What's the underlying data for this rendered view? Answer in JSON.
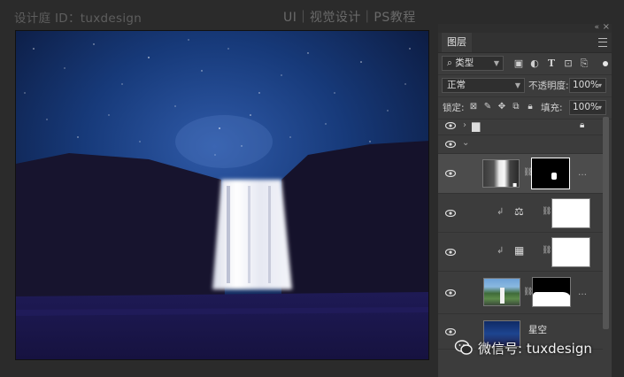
{
  "header": {
    "left_text": "设计庭 ID：tuxdesign",
    "right_text": "UI｜视觉设计｜PS教程"
  },
  "panel": {
    "tab": "图层",
    "collapse_icon": "double-chevron-icon",
    "filter": {
      "label": "类型",
      "icons": [
        "image-filter-icon",
        "adjustment-filter-icon",
        "type-filter-icon",
        "shape-filter-icon",
        "smart-object-filter-icon"
      ]
    },
    "blend_mode": "正常",
    "opacity_label": "不透明度:",
    "opacity_value": "100%",
    "lock_label": "锁定:",
    "fill_label": "填充:",
    "fill_value": "100%",
    "layers": [
      {
        "type": "group",
        "expanded": false,
        "locked": true
      },
      {
        "type": "group",
        "expanded": true
      },
      {
        "type": "smart-object",
        "selected": true
      },
      {
        "type": "adjustment",
        "icon": "balance-icon"
      },
      {
        "type": "adjustment",
        "icon": "grid-icon"
      },
      {
        "type": "image-with-mask"
      },
      {
        "type": "image",
        "name": "星空"
      }
    ]
  },
  "watermark": "微信号: tuxdesign",
  "colors": {
    "panel_bg": "#3c3c3c",
    "selected_layer": "#4c4c4c",
    "night_sky": "#0d1a4a"
  }
}
